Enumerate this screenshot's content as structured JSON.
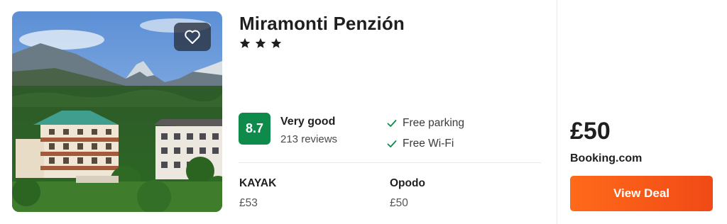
{
  "hotel": {
    "name": "Miramonti Penzión",
    "star_count": 3,
    "score": "8.7",
    "rating_label": "Very good",
    "reviews": "213 reviews",
    "amenities": [
      "Free parking",
      "Free Wi-Fi"
    ],
    "favorite_icon": "heart-outline-icon",
    "check_icon": "check-icon"
  },
  "providers": [
    {
      "name": "KAYAK",
      "price": "£53"
    },
    {
      "name": "Opodo",
      "price": "£50"
    }
  ],
  "best_deal": {
    "price": "£50",
    "provider": "Booking.com",
    "button_label": "View Deal"
  },
  "colors": {
    "score_badge": "#0e8b4a",
    "deal_button": "#ff5b17",
    "check": "#0e8b4a"
  }
}
